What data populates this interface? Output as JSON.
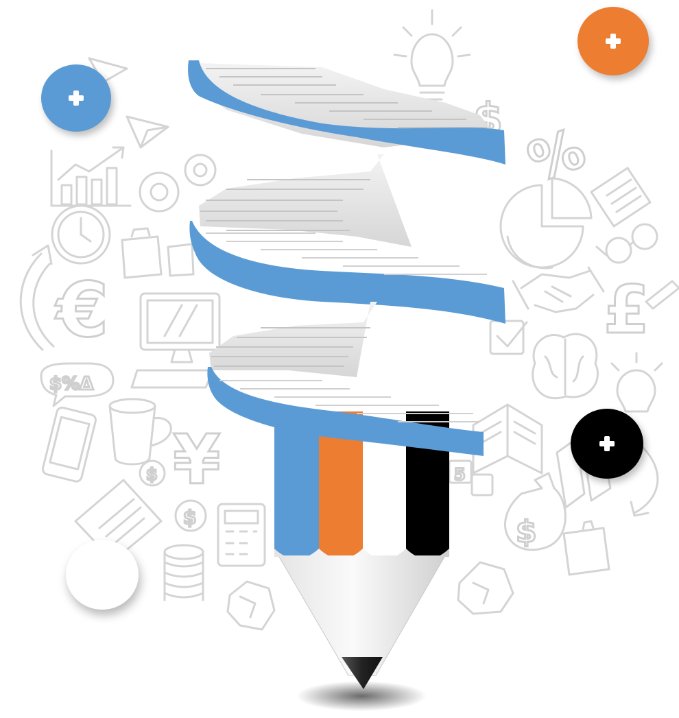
{
  "colors": {
    "blue": "#5b9bd5",
    "orange": "#ed7d31",
    "black": "#000000",
    "white": "#ffffff",
    "doodle": "#d4d4d4"
  },
  "buttons": [
    {
      "id": "blue",
      "icon": "plus-icon",
      "color": "#5b9bd5"
    },
    {
      "id": "orange",
      "icon": "plus-icon",
      "color": "#ed7d31"
    },
    {
      "id": "black",
      "icon": "plus-icon",
      "color": "#000000"
    }
  ],
  "pencil_stripes": [
    "#5b9bd5",
    "#ed7d31",
    "#ffffff",
    "#000000"
  ],
  "doodles": {
    "euro": "€",
    "pound": "£",
    "yen": "¥",
    "dollar": "$",
    "percent": "%",
    "chat": "$%Δ"
  }
}
